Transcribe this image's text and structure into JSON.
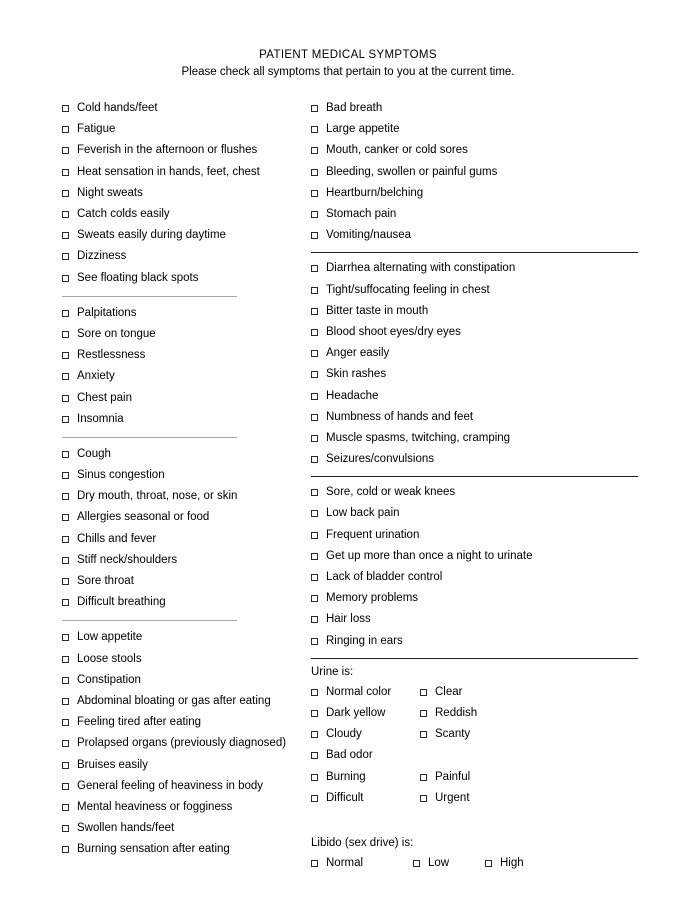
{
  "header": {
    "title": "PATIENT MEDICAL SYMPTOMS",
    "subtitle": "Please check all symptoms that pertain to you at the current time."
  },
  "left_column": {
    "groups": [
      {
        "items": [
          "Cold hands/feet",
          "Fatigue",
          "Feverish in the afternoon or flushes",
          "Heat sensation in hands, feet, chest",
          "Night sweats",
          "Catch colds easily",
          "Sweats easily during daytime",
          "Dizziness",
          "See floating black spots"
        ]
      },
      {
        "items": [
          "Palpitations",
          "Sore on tongue",
          "Restlessness",
          "Anxiety",
          "Chest pain",
          "Insomnia"
        ]
      },
      {
        "items": [
          "Cough",
          "Sinus congestion",
          "Dry mouth, throat, nose, or skin",
          "Allergies seasonal or food",
          "Chills and fever",
          "Stiff neck/shoulders",
          "Sore throat",
          "Difficult breathing"
        ]
      },
      {
        "items": [
          "Low appetite",
          "Loose stools",
          "Constipation",
          "Abdominal bloating or gas after eating",
          "Feeling tired after eating",
          "Prolapsed organs (previously diagnosed)",
          "Bruises easily",
          "General feeling of heaviness in body",
          "Mental heaviness or fogginess",
          "Swollen hands/feet",
          "Burning sensation after eating"
        ]
      }
    ]
  },
  "right_column": {
    "groups": [
      {
        "items": [
          "Bad breath",
          "Large appetite",
          "Mouth, canker or cold sores",
          "Bleeding, swollen or painful gums",
          "Heartburn/belching",
          "Stomach pain",
          "Vomiting/nausea"
        ]
      },
      {
        "items": [
          "Diarrhea alternating with constipation",
          "Tight/suffocating feeling in chest",
          "Bitter taste in mouth",
          "Blood shoot eyes/dry eyes",
          "Anger easily",
          "Skin rashes",
          "Headache",
          "Numbness of hands and feet",
          "Muscle spasms, twitching, cramping",
          "Seizures/convulsions"
        ]
      },
      {
        "items": [
          "Sore, cold or weak knees",
          "Low back pain",
          "Frequent urination",
          "Get up more than once a night to urinate",
          "Lack of bladder control",
          "Memory problems",
          "Hair loss",
          "Ringing in ears"
        ]
      }
    ],
    "urine": {
      "label": "Urine is:",
      "rows": [
        {
          "a": "Normal color",
          "b": "Clear"
        },
        {
          "a": "Dark yellow",
          "b": "Reddish"
        },
        {
          "a": "Cloudy",
          "b": "Scanty"
        },
        {
          "a": "Bad odor",
          "b": ""
        },
        {
          "a": "Burning",
          "b": "Painful"
        },
        {
          "a": "Difficult",
          "b": "Urgent"
        }
      ]
    },
    "libido": {
      "label": "Libido (sex drive) is:",
      "options": [
        "Normal",
        "Low",
        "High"
      ]
    }
  }
}
